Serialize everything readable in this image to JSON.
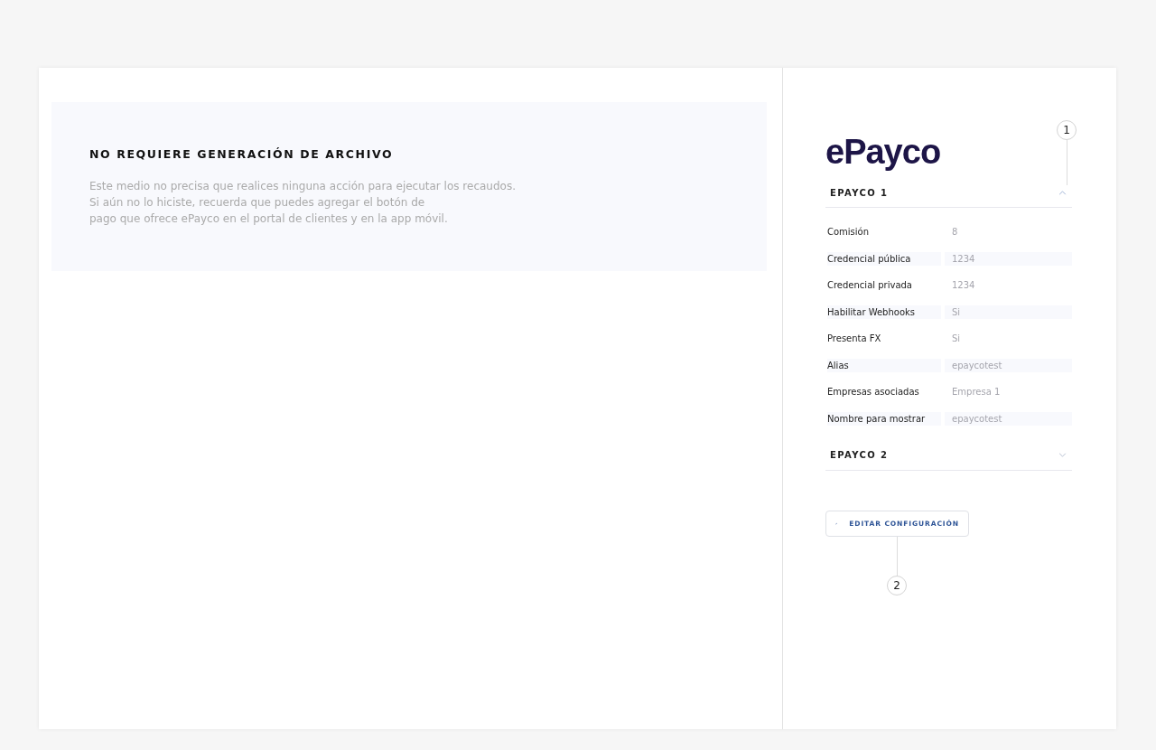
{
  "notice": {
    "title": "NO REQUIERE GENERACIÓN DE ARCHIVO",
    "text": "Este medio no precisa que realices ninguna acción para ejecutar los recaudos.\nSi aún no lo hiciste, recuerda que puedes agregar el botón de\npago que ofrece ePayco en el portal de clientes y en la app móvil."
  },
  "provider": {
    "logo": "ePayco",
    "accounts": [
      {
        "title": "EPAYCO 1",
        "expanded": true,
        "fields": [
          {
            "label": "Comisión",
            "value": "8"
          },
          {
            "label": "Credencial pública",
            "value": "1234"
          },
          {
            "label": "Credencial privada",
            "value": "1234"
          },
          {
            "label": "Habilitar Webhooks",
            "value": "Si"
          },
          {
            "label": "Presenta FX",
            "value": "Si"
          },
          {
            "label": "Alias",
            "value": "epaycotest"
          },
          {
            "label": "Empresas asociadas",
            "value": "Empresa 1"
          },
          {
            "label": "Nombre para mostrar",
            "value": "epaycotest"
          }
        ]
      },
      {
        "title": "EPAYCO 2",
        "expanded": false
      }
    ]
  },
  "edit_button": {
    "label": "EDITAR CONFIGURACIÓN"
  },
  "callouts": [
    {
      "label": "1"
    },
    {
      "label": "2"
    }
  ]
}
